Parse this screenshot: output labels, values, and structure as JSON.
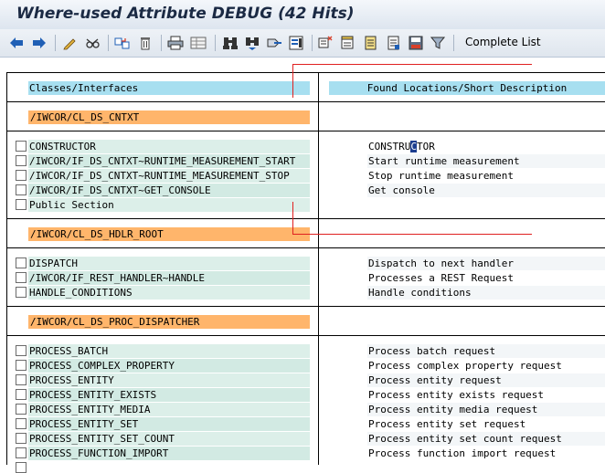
{
  "window": {
    "title": "Where-used Attribute DEBUG (42 Hits)"
  },
  "toolbar": {
    "buttons": [
      {
        "name": "back-icon"
      },
      {
        "name": "forward-icon"
      },
      {
        "name": "edit-icon"
      },
      {
        "name": "display-icon"
      },
      {
        "name": "where-used-icon"
      },
      {
        "name": "delete-icon"
      },
      {
        "name": "print-icon"
      },
      {
        "name": "table-icon"
      },
      {
        "name": "find-icon"
      },
      {
        "name": "find-next-icon"
      },
      {
        "name": "export-icon"
      },
      {
        "name": "select-all-icon"
      },
      {
        "name": "deselect-icon"
      },
      {
        "name": "select-block-icon"
      },
      {
        "name": "document-icon"
      },
      {
        "name": "save-list-icon"
      },
      {
        "name": "filter-icon"
      }
    ],
    "complete_list_label": "Complete List"
  },
  "columns": {
    "left_header": "Classes/Interfaces",
    "right_header": "Found Locations/Short Description"
  },
  "groups": [
    {
      "class_name": "/IWCOR/CL_DS_CNTXT",
      "items": [
        {
          "name": "CONSTRUCTOR",
          "desc_pre": "CONSTRU",
          "desc_cursor": "C",
          "desc_post": "TOR"
        },
        {
          "name": "/IWCOR/IF_DS_CNTXT~RUNTIME_MEASUREMENT_START",
          "desc": "Start runtime measurement"
        },
        {
          "name": "/IWCOR/IF_DS_CNTXT~RUNTIME_MEASUREMENT_STOP",
          "desc": "Stop runtime measurement"
        },
        {
          "name": "/IWCOR/IF_DS_CNTXT~GET_CONSOLE",
          "desc": "Get console"
        },
        {
          "name": "Public Section",
          "desc": ""
        }
      ]
    },
    {
      "class_name": "/IWCOR/CL_DS_HDLR_ROOT",
      "items": [
        {
          "name": "DISPATCH",
          "desc": "Dispatch to next handler"
        },
        {
          "name": "/IWCOR/IF_REST_HANDLER~HANDLE",
          "desc": "Processes a REST Request"
        },
        {
          "name": "HANDLE_CONDITIONS",
          "desc": "Handle conditions"
        }
      ]
    },
    {
      "class_name": "/IWCOR/CL_DS_PROC_DISPATCHER",
      "items": [
        {
          "name": "PROCESS_BATCH",
          "desc": "Process batch request"
        },
        {
          "name": "PROCESS_COMPLEX_PROPERTY",
          "desc": "Process complex property request"
        },
        {
          "name": "PROCESS_ENTITY",
          "desc": "Process entity request"
        },
        {
          "name": "PROCESS_ENTITY_EXISTS",
          "desc": "Process entity exists request"
        },
        {
          "name": "PROCESS_ENTITY_MEDIA",
          "desc": "Process entity media request"
        },
        {
          "name": "PROCESS_ENTITY_SET",
          "desc": "Process entity set request"
        },
        {
          "name": "PROCESS_ENTITY_SET_COUNT",
          "desc": "Process entity set count request"
        },
        {
          "name": "PROCESS_FUNCTION_IMPORT",
          "desc": "Process function import request"
        }
      ]
    }
  ]
}
